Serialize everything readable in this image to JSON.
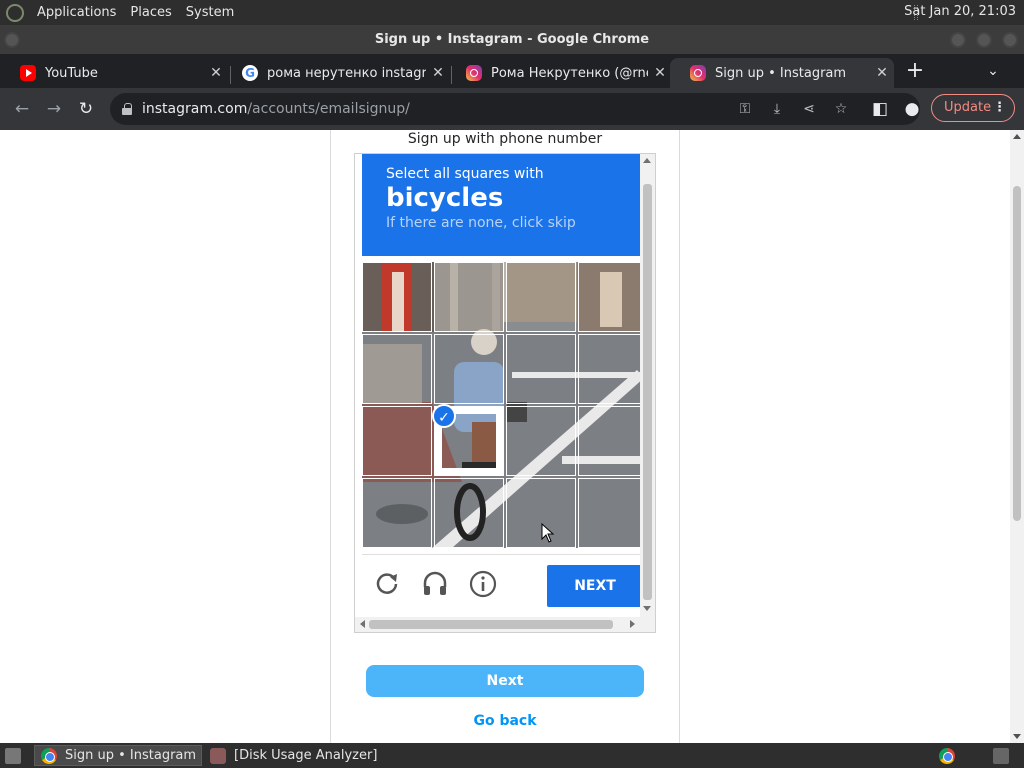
{
  "top_panel": {
    "menus": [
      "Applications",
      "Places",
      "System"
    ],
    "clock": "Sat Jan 20, 21:03"
  },
  "window": {
    "title": "Sign up • Instagram - Google Chrome"
  },
  "tabs": [
    {
      "label": "YouTube",
      "icon": "youtube-icon"
    },
    {
      "label": "рома нерутенко instagram",
      "icon": "google-icon"
    },
    {
      "label": "Рома Некрутенко (@rnek",
      "icon": "instagram-icon"
    },
    {
      "label": "Sign up • Instagram",
      "icon": "instagram-icon",
      "active": true
    }
  ],
  "toolbar": {
    "url_host": "instagram.com",
    "url_path": "/accounts/emailsignup/",
    "update_label": "Update"
  },
  "page": {
    "phone_signup_text": "Sign up with phone number",
    "next_button": "Next",
    "go_back": "Go back"
  },
  "captcha": {
    "instruction": "Select all squares with",
    "keyword": "bicycles",
    "hint": "If there are none, click skip",
    "grid_rows": 4,
    "grid_cols": 4,
    "selected_tiles": [
      9
    ],
    "next_label": "NEXT",
    "footer_icons": [
      "reload-icon",
      "audio-icon",
      "info-icon"
    ]
  },
  "taskbar": {
    "items": [
      {
        "label": "Sign up • Instagram ...",
        "active": true
      },
      {
        "label": "[Disk Usage Analyzer]",
        "active": false
      }
    ]
  },
  "colors": {
    "captcha_blue": "#1a73e8",
    "instagram_button": "#4cb5f9",
    "instagram_link": "#0095f6",
    "update_accent": "#f28b82"
  }
}
